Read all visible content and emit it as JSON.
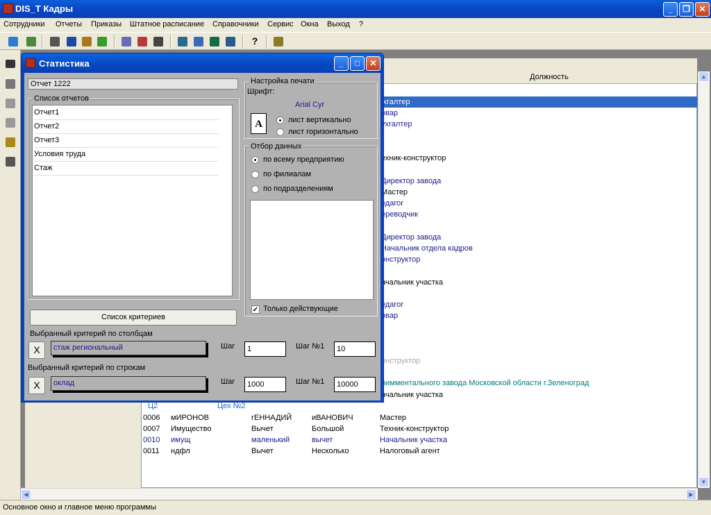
{
  "window": {
    "title": "DIS_T Кадры"
  },
  "menu": [
    "Сотрудники",
    "Отчеты",
    "Приказы",
    "Штатное расписание",
    "Справочники",
    "Сервис",
    "Окна",
    "Выход",
    "?"
  ],
  "toolbar_icons": [
    "staff-icon",
    "tools-icon",
    "search-user-icon",
    "report-icon",
    "tree-icon",
    "palm-icon",
    "calc-icon",
    "box-icon",
    "table-icon",
    "filter-icon",
    "edit-icon",
    "grid-icon",
    "save-icon",
    "help-icon",
    "exit-icon"
  ],
  "grid": {
    "header_col": "Должность",
    "positions": [
      "ухгалтер",
      "овар",
      "ухгалтер",
      "ехник-конструктор",
      "Директор завода",
      "Мастер",
      "едагог",
      "ереводчик",
      "Директор завода",
      "Начальник отдела кадров",
      "онструктор",
      "ачальник участка",
      "едагог",
      "овар",
      "онструктор",
      "римментального завода Московской области г.Зеленоград",
      "ачальник участка"
    ],
    "group": {
      "code": "Ц2",
      "name": "Цех №2"
    },
    "rows": [
      {
        "id": "0006",
        "c1": "мИРОНОВ",
        "c2": "гЕННАДИЙ",
        "c3": "иВАНОВИЧ",
        "c4": "Мастер"
      },
      {
        "id": "0007",
        "c1": "Имущество",
        "c2": "Вычет",
        "c3": "Большой",
        "c4": "Техник-конструктор"
      },
      {
        "id": "0010",
        "c1": "имущ",
        "c2": "маленький",
        "c3": "вычет",
        "c4": "Начальник участка"
      },
      {
        "id": "0011",
        "c1": "ндфл",
        "c2": "Вычет",
        "c3": "Несколько",
        "c4": "Налоговый агент"
      }
    ]
  },
  "status": "Основное окно и главное меню программы",
  "dialog": {
    "title": "Статистика",
    "report_name": "Отчет 1222",
    "reports_label": "Список отчетов",
    "reports": [
      "Отчет1",
      "Отчет2",
      "Отчет3",
      "Условия труда",
      "Стаж"
    ],
    "print_group": "Настройка печати",
    "font_label": "Шрифт:",
    "font_value": "Arial Cyr",
    "portrait": "лист вертикально",
    "landscape": "лист горизонтально",
    "filter_group": "Отбор данных",
    "opt_all": "по всему предприятию",
    "opt_branches": "по филиалам",
    "opt_depts": "по подразделениям",
    "active_only": "Только действующие",
    "criteria_button": "Список критериев",
    "col_criterion_label": "Выбранный критерий по столбцам",
    "col_criterion": "стаж региональный",
    "row_criterion_label": "Выбранный критерий по строкам",
    "row_criterion": "оклад",
    "step_label": "Шаг",
    "step1_label": "Шаг №1",
    "col_step": "1",
    "col_step1": "10",
    "row_step": "1000",
    "row_step1": "10000",
    "clear_glyph": "X"
  }
}
